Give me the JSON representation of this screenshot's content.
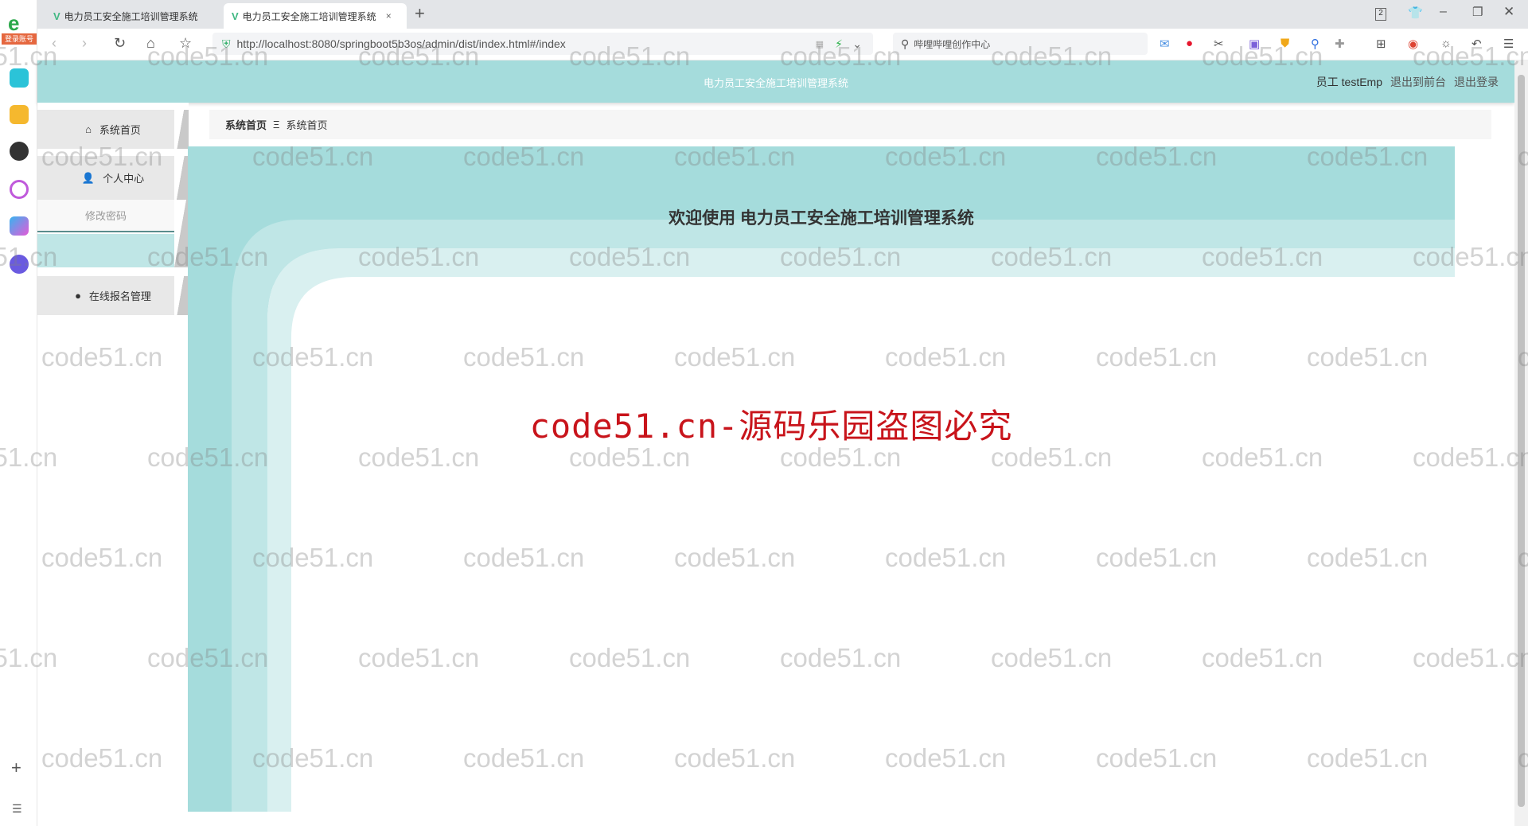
{
  "browser": {
    "tabs": [
      {
        "label": "电力员工安全施工培训管理系统",
        "active": false
      },
      {
        "label": "电力员工安全施工培训管理系统",
        "active": true
      }
    ],
    "new_tab": "+",
    "close": "×",
    "url": "http://localhost:8080/springboot5b3os/admin/dist/index.html#/index",
    "search_placeholder": "哔哩哔哩创作中心",
    "login_badge": "登录账号",
    "window_count": "2"
  },
  "header": {
    "title": "电力员工安全施工培训管理系统",
    "user": "员工 testEmp",
    "to_front": "退出到前台",
    "logout": "退出登录"
  },
  "sidebar": {
    "items": [
      {
        "label": "系统首页",
        "icon": "home-icon"
      },
      {
        "label": "个人中心",
        "icon": "user-icon"
      },
      {
        "label": "修改密码",
        "icon": ""
      },
      {
        "label": "在线报名管理",
        "icon": "bulb-icon"
      }
    ]
  },
  "breadcrumb": {
    "root": "系统首页",
    "separator": "Ξ",
    "current": "系统首页"
  },
  "main": {
    "welcome": "欢迎使用 电力员工安全施工培训管理系统",
    "notice": "code51.cn-源码乐园盗图必究"
  },
  "watermark": "code51.cn",
  "colors": {
    "accent": "#a5dcdc",
    "notice": "#c8141b"
  }
}
